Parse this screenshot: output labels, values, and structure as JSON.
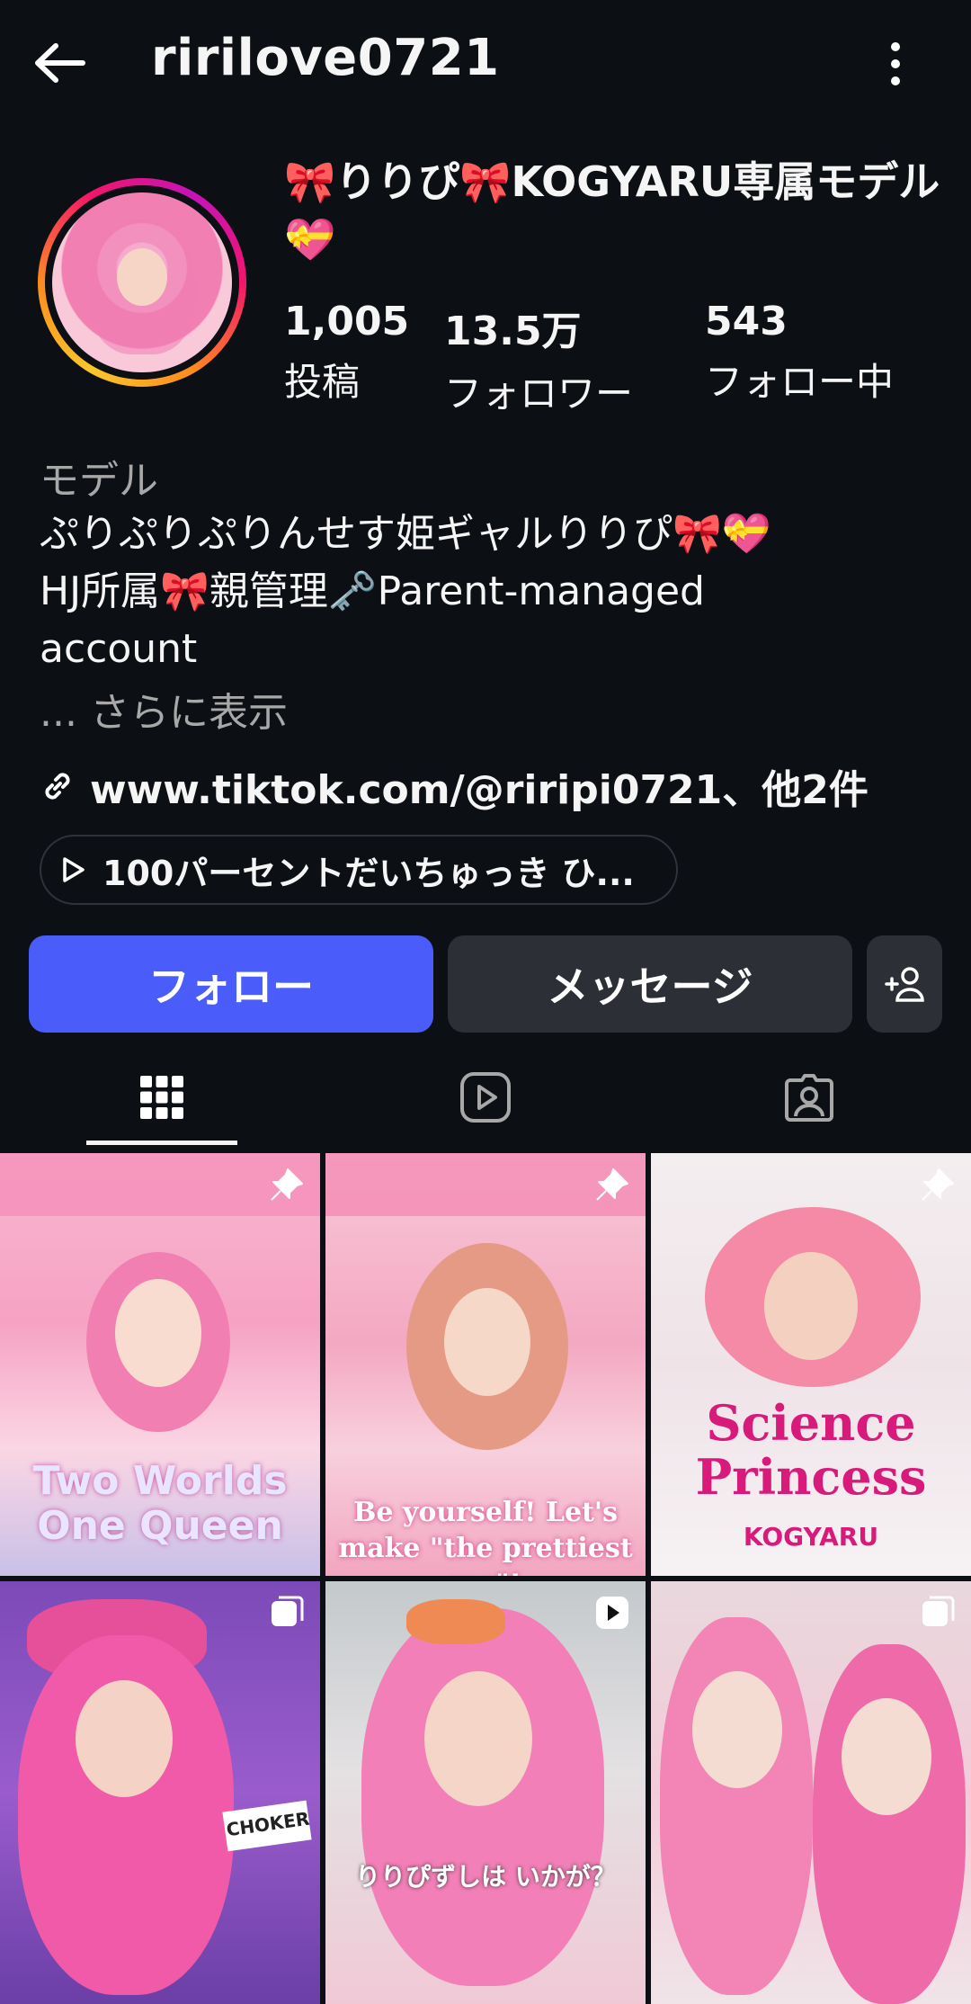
{
  "header": {
    "username": "ririlove0721"
  },
  "profile": {
    "display_name": "🎀りりぴ🎀KOGYARU専属モデル💝",
    "stats": [
      {
        "value": "1,005",
        "label": "投稿"
      },
      {
        "value": "13.5万",
        "label": "フォロワー"
      },
      {
        "value": "543",
        "label": "フォロー中"
      }
    ],
    "category": "モデル",
    "bio_line1": "ぷりぷりぷりんせす姫ギャルりりぴ🎀💝",
    "bio_line2": "HJ所属🎀親管理🗝️Parent-managed",
    "bio_line3": "account",
    "more": "... さらに表示",
    "link": "www.tiktok.com/@riripi0721、他2件",
    "music": "100パーセントだいちゅっき ひ..."
  },
  "buttons": {
    "follow": "フォロー",
    "message": "メッセージ"
  },
  "grid": {
    "tiles": [
      {
        "caption": "Two Worlds One Queen",
        "badge": "pin"
      },
      {
        "caption": "Be yourself! Let's make \"the prettiest me\"!",
        "badge": "pin"
      },
      {
        "caption": "Science Princess",
        "badge": "pin"
      },
      {
        "caption": "CHOKER",
        "badge": "carousel"
      },
      {
        "caption": "りりぴずしは いかが？",
        "badge": "reel"
      },
      {
        "caption": "",
        "badge": "carousel"
      }
    ],
    "brand_text": "KOGYARU"
  },
  "colors": {
    "background": "#0c0f14",
    "follow_button": "#4a5dfa",
    "secondary_button": "#2c2f35",
    "muted_text": "#a8a8a8"
  }
}
